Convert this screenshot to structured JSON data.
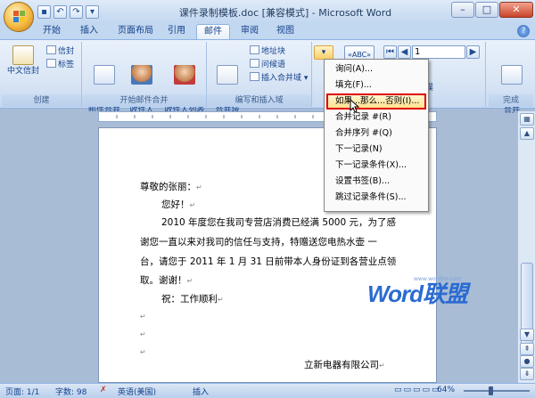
{
  "window": {
    "title": "课件录制模板.doc [兼容模式] - Microsoft Word",
    "controls": {
      "minimize": "–",
      "maximize": "□",
      "close": "✕"
    }
  },
  "qat": {
    "icons": [
      "save-icon",
      "undo-icon",
      "redo-icon",
      "customize-icon"
    ]
  },
  "tabs": [
    {
      "label": "开始"
    },
    {
      "label": "插入"
    },
    {
      "label": "页面布局"
    },
    {
      "label": "引用"
    },
    {
      "label": "邮件",
      "active": true
    },
    {
      "label": "审阅"
    },
    {
      "label": "视图"
    }
  ],
  "ribbon": {
    "create": {
      "label": "创建",
      "chinese_envelope": "中文信封",
      "envelope": "信封",
      "labels": "标签"
    },
    "start_merge": {
      "label": "开始邮件合并",
      "start": "开始\n邮件合并",
      "select": "选择\n收件人",
      "edit": "编辑\n收件人列表"
    },
    "write_insert": {
      "label": "编写和插入域",
      "highlight": "突出显示\n合并域",
      "address_block": "地址块",
      "greeting": "问候语",
      "insert_field": "插入合并域"
    },
    "preview": {
      "record": "1",
      "error_check": "错误"
    },
    "finish": {
      "label": "完成",
      "finish_merge": "完成并\n合并"
    }
  },
  "dropdown": {
    "items": [
      "询问(A)...",
      "填充(F)...",
      "如果...那么...否则(I)...",
      "合并记录 #(R)",
      "合并序列 #(Q)",
      "下一记录(N)",
      "下一记录条件(X)...",
      "设置书签(B)...",
      "跳过记录条件(S)..."
    ],
    "highlighted_index": 2
  },
  "document": {
    "lines": [
      "尊敬的张丽：",
      "您好！",
      "2010 年度您在我司专营店消费已经满 5000 元，为了感",
      "谢您一直以来对我司的信任与支持，特赠送您电热水壶 一",
      "台，请您于 2011 年 1 月 31 日前带本人身份证到各营业点领",
      "取。谢谢！",
      "祝：工作顺利",
      "立新电器有限公司"
    ]
  },
  "watermark": {
    "text": "Word联盟",
    "url": "www.wordlm.com"
  },
  "status": {
    "page": "页面: 1/1",
    "words": "字数: 98",
    "language": "英语(美国)",
    "mode": "插入",
    "zoom": "64%"
  }
}
